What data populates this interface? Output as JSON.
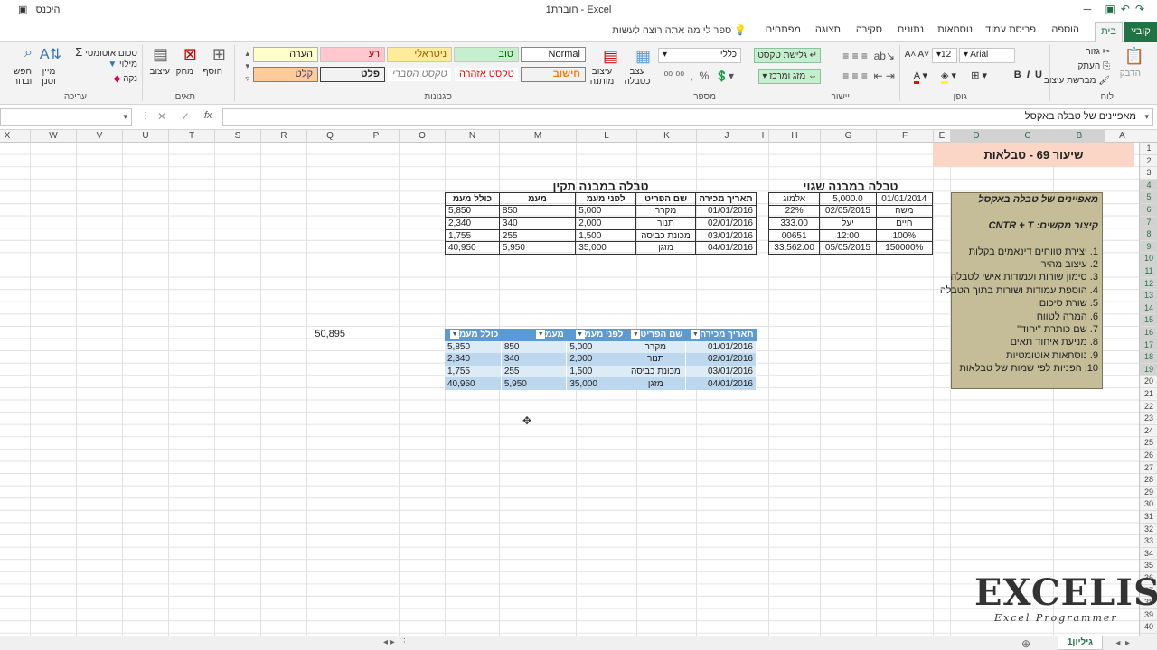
{
  "window": {
    "title": "חוברת1 - Excel",
    "user": "היכנס"
  },
  "ribbon_tabs": [
    "קובץ",
    "בית",
    "הוספה",
    "פריסת עמוד",
    "נוסחאות",
    "נתונים",
    "סקירה",
    "תצוגה",
    "מפתחים"
  ],
  "tell_me": "ספר לי מה אתה רוצה לעשות",
  "ribbon": {
    "clipboard": {
      "label": "לוח",
      "paste": "הדבק",
      "cut": "גזור",
      "copy": "העתק",
      "format_painter": "מברשת עיצוב"
    },
    "font": {
      "label": "גופן",
      "name": "Arial",
      "size": "12"
    },
    "alignment": {
      "label": "יישור",
      "wrap": "גלישת טקסט",
      "merge": "מזג ומרכז"
    },
    "number": {
      "label": "מספר",
      "format": "כללי"
    },
    "styles": {
      "label": "סגנונות",
      "conditional": "עיצוב מותנה",
      "as_table": "עצב כטבלה",
      "normal": "Normal",
      "good": "טוב",
      "neutral": "ניטראלי",
      "bad": "רע",
      "note": "הערה",
      "calc": "חישוב",
      "warning": "טקסט אזהרה",
      "explanatory": "טקסט הסברי",
      "output": "פלט",
      "input": "קלט"
    },
    "cells": {
      "label": "תאים",
      "insert": "הוסף",
      "delete": "מחק",
      "format": "עיצוב"
    },
    "editing": {
      "label": "עריכה",
      "autosum": "סכום אוטומטי",
      "fill": "מילוי",
      "clear": "נקה",
      "sort": "מיין וסנן",
      "find": "חפש ובחר"
    }
  },
  "formula_bar": {
    "fx": "fx",
    "content": "מאפיינים של טבלה באקסל"
  },
  "columns": [
    "A",
    "B",
    "C",
    "D",
    "E",
    "F",
    "G",
    "H",
    "I",
    "J",
    "K",
    "L",
    "M",
    "N",
    "O",
    "P",
    "Q",
    "R",
    "S",
    "T",
    "U",
    "V",
    "W",
    "X"
  ],
  "rows": [
    "1",
    "2",
    "3",
    "4",
    "5",
    "6",
    "7",
    "8",
    "9",
    "10",
    "11",
    "12",
    "13",
    "14",
    "15",
    "16",
    "17",
    "18",
    "19",
    "20",
    "21",
    "22",
    "23",
    "24",
    "25",
    "26",
    "27",
    "28",
    "29",
    "30",
    "31",
    "32",
    "33",
    "34",
    "35",
    "36",
    "37",
    "38",
    "39",
    "40"
  ],
  "lesson_title": "שיעור 69 - טבלאות",
  "info_box": [
    {
      "text": "מאפיינים של טבלה באקסל",
      "bold": true
    },
    {
      "text": "",
      "bold": false
    },
    {
      "text": "קיצור מקשים: CNTR + T",
      "bold": true
    },
    {
      "text": "",
      "bold": false
    },
    {
      "text": "1. יצירת טווחים דינאמים בקלות",
      "bold": false
    },
    {
      "text": "2. עיצוב מהיר",
      "bold": false
    },
    {
      "text": "3. סימון שורות ועמודות אישי לטבלה",
      "bold": false
    },
    {
      "text": "4. הוספת עמודות ושורות בתוך הטבלה",
      "bold": false
    },
    {
      "text": "5. שורת סיכום",
      "bold": false
    },
    {
      "text": "6. המרה לטווח",
      "bold": false
    },
    {
      "text": "7. שם כותרת \"יחוד\"",
      "bold": false
    },
    {
      "text": "8. מניעת איחוד תאים",
      "bold": false
    },
    {
      "text": "9. נוסחאות אוטומטיות",
      "bold": false
    },
    {
      "text": "10. הפניות לפי שמות של טבלאות",
      "bold": false
    }
  ],
  "wrong_table": {
    "title": "טבלה במבנה שגוי",
    "rows": [
      [
        "01/01/2014",
        "5,000.0",
        "אלמוג"
      ],
      [
        "משה",
        "02/05/2015",
        "22%"
      ],
      [
        "חיים",
        "יעל",
        "333.00"
      ],
      [
        "100%",
        "12:00",
        "00651"
      ],
      [
        "150000%",
        "05/05/2015",
        "33,562.00"
      ]
    ]
  },
  "correct_table": {
    "title": "טבלה במבנה תקין",
    "headers": [
      "תאריך מכירה",
      "שם הפריט",
      "לפני מעמ",
      "מעמ",
      "כולל מעמ"
    ],
    "rows": [
      [
        "01/01/2016",
        "מקרר",
        "5,000",
        "850",
        "5,850"
      ],
      [
        "02/01/2016",
        "תנור",
        "2,000",
        "340",
        "2,340"
      ],
      [
        "03/01/2016",
        "מכונת כביסה",
        "1,500",
        "255",
        "1,755"
      ],
      [
        "04/01/2016",
        "מזגן",
        "35,000",
        "5,950",
        "40,950"
      ]
    ]
  },
  "formatted_table": {
    "headers": [
      "תאריך מכירה",
      "שם הפריט",
      "לפני מעמ",
      "מעמ",
      "כולל מעמ"
    ],
    "rows": [
      [
        "01/01/2016",
        "מקרר",
        "5,000",
        "850",
        "5,850"
      ],
      [
        "02/01/2016",
        "תנור",
        "2,000",
        "340",
        "2,340"
      ],
      [
        "03/01/2016",
        "מכונת כביסה",
        "1,500",
        "255",
        "1,755"
      ],
      [
        "04/01/2016",
        "מזגן",
        "35,000",
        "5,950",
        "40,950"
      ]
    ]
  },
  "q_total": "50,895",
  "sheet_tab": "גיליון1",
  "logo": {
    "main": "EXCELIST",
    "sub": "Excel Programmer"
  }
}
